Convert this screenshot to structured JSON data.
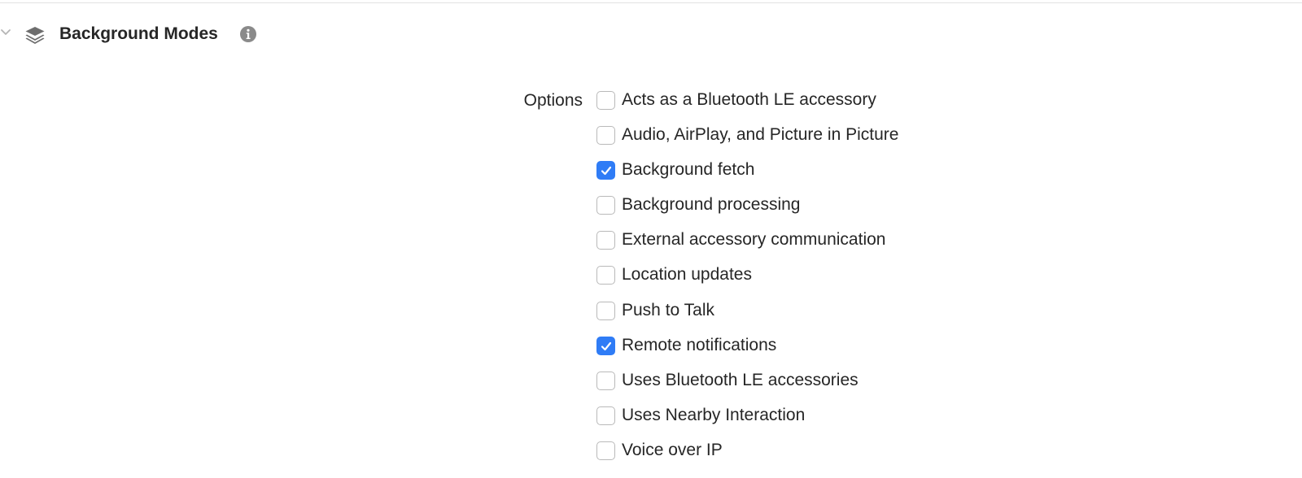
{
  "section": {
    "title": "Background Modes",
    "expanded": true,
    "icons": {
      "disclosure": "chevron-down-icon",
      "capability": "layers-icon",
      "info": "info-icon"
    }
  },
  "options": {
    "label": "Options",
    "items": [
      {
        "label": "Acts as a Bluetooth LE accessory",
        "checked": false
      },
      {
        "label": "Audio, AirPlay, and Picture in Picture",
        "checked": false
      },
      {
        "label": "Background fetch",
        "checked": true
      },
      {
        "label": "Background processing",
        "checked": false
      },
      {
        "label": "External accessory communication",
        "checked": false
      },
      {
        "label": "Location updates",
        "checked": false
      },
      {
        "label": "Push to Talk",
        "checked": false
      },
      {
        "label": "Remote notifications",
        "checked": true
      },
      {
        "label": "Uses Bluetooth LE accessories",
        "checked": false
      },
      {
        "label": "Uses Nearby Interaction",
        "checked": false
      },
      {
        "label": "Voice over IP",
        "checked": false
      }
    ]
  },
  "colors": {
    "accent": "#2f7cf6",
    "text": "#262626",
    "icon": "#6e6e6e"
  }
}
